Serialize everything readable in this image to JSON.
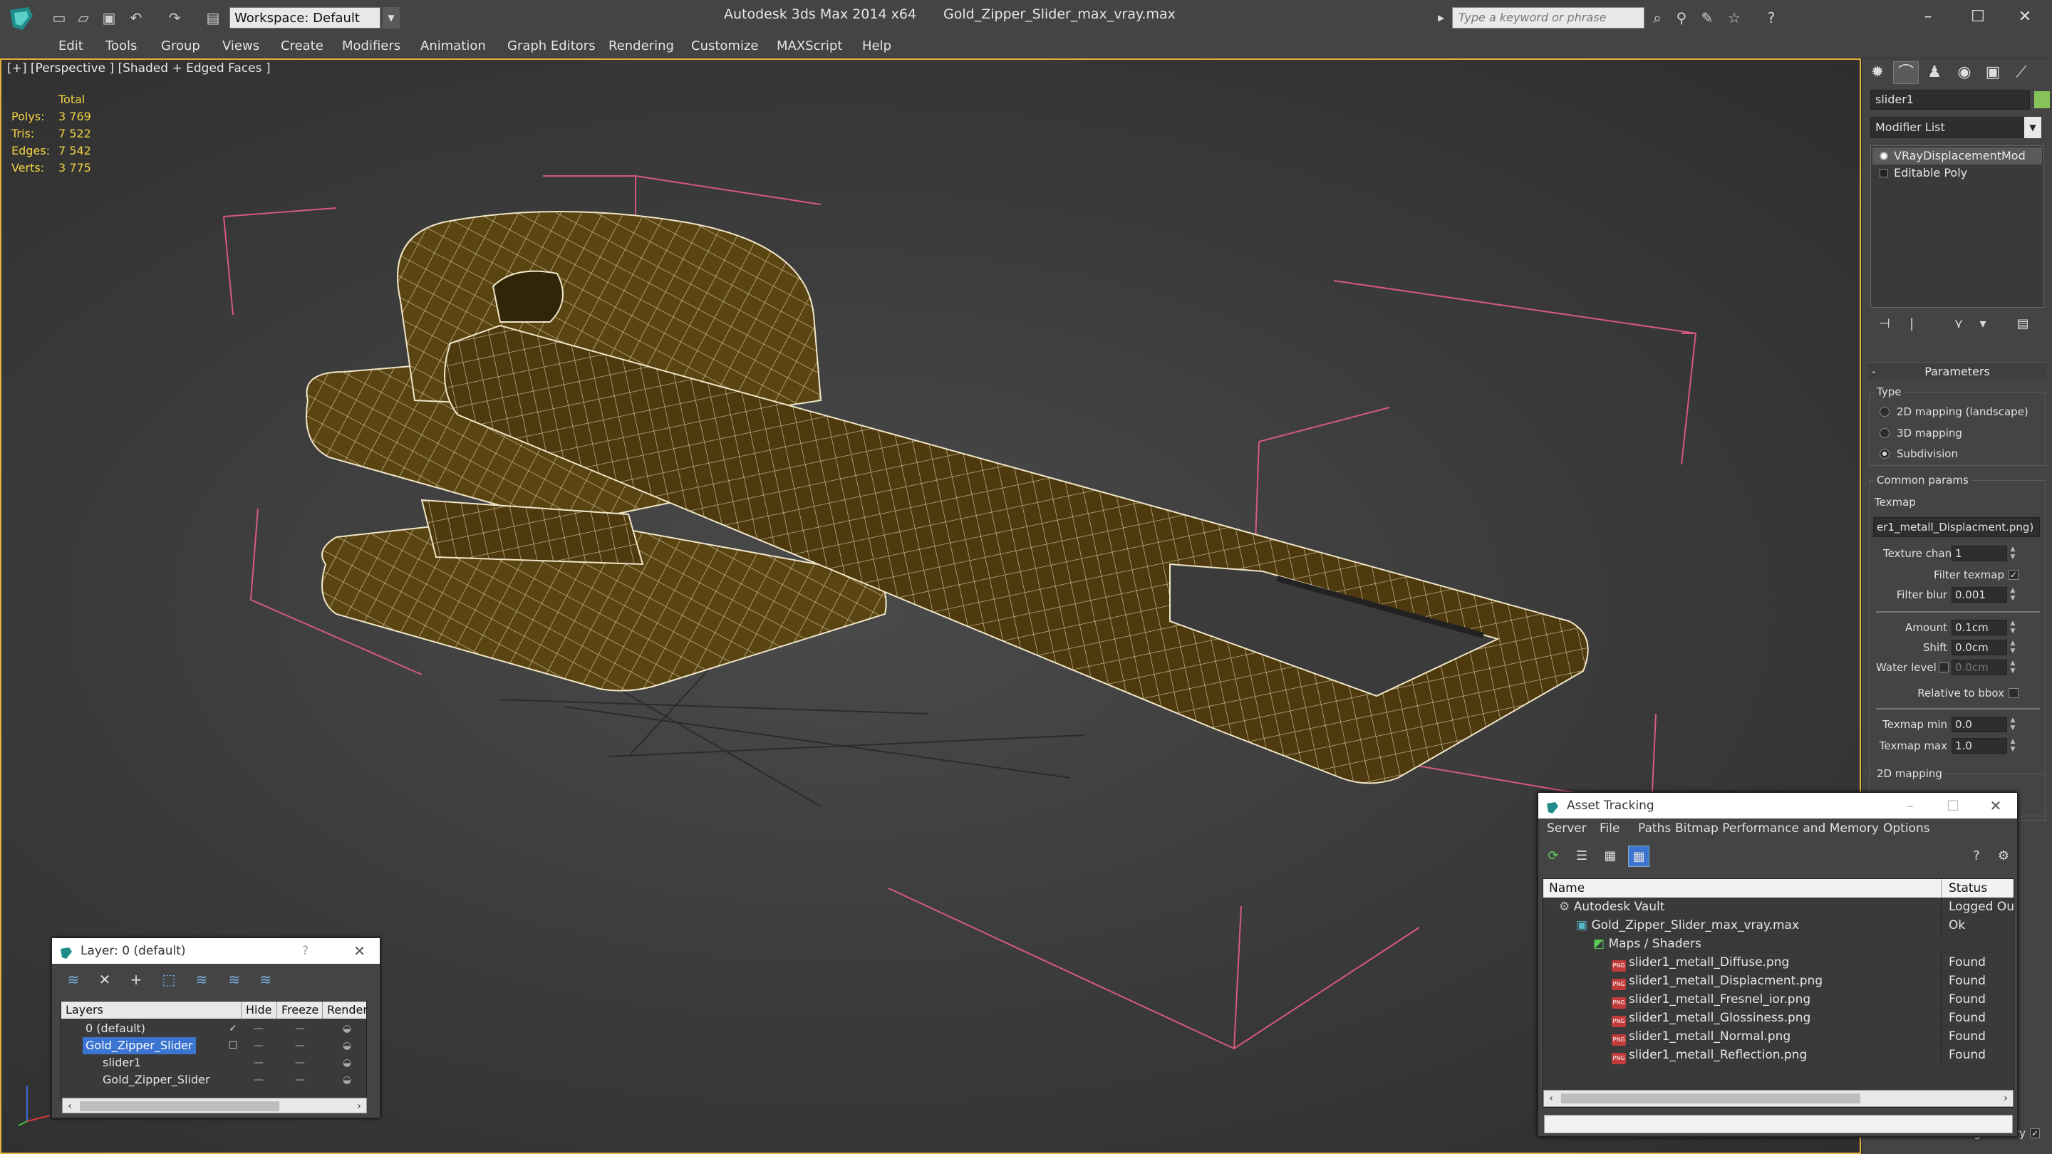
{
  "titlebar": {
    "workspace": "Workspace: Default",
    "app_title": "Autodesk 3ds Max  2014 x64",
    "file_name": "Gold_Zipper_Slider_max_vray.max",
    "search_placeholder": "Type a keyword or phrase"
  },
  "menu": [
    "Edit",
    "Tools",
    "Group",
    "Views",
    "Create",
    "Modifiers",
    "Animation",
    "Graph Editors",
    "Rendering",
    "Customize",
    "MAXScript",
    "Help"
  ],
  "viewport": {
    "label": "[+] [Perspective ] [Shaded + Edged Faces ]",
    "stats": {
      "header": "Total",
      "rows": [
        {
          "k": "Polys:",
          "v": "3 769"
        },
        {
          "k": "Tris:",
          "v": "7 522"
        },
        {
          "k": "Edges:",
          "v": "7 542"
        },
        {
          "k": "Verts:",
          "v": "3 775"
        }
      ]
    }
  },
  "command_panel": {
    "object_name": "slider1",
    "object_color": "#86c45a",
    "modifier_list": "Modifier List",
    "stack": [
      "VRayDisplacementMod",
      "Editable Poly"
    ],
    "rollout": "Parameters",
    "type_group": "Type",
    "type_options": [
      "2D mapping (landscape)",
      "3D mapping",
      "Subdivision"
    ],
    "common_group": "Common params",
    "texmap_label": "Texmap",
    "texmap_value": "er1_metall_Displacment.png)",
    "texture_chan_label": "Texture chan",
    "texture_chan_value": "1",
    "filter_texmap_label": "Filter texmap",
    "filter_blur_label": "Filter blur",
    "filter_blur_value": "0.001",
    "amount_label": "Amount",
    "amount_value": "0.1cm",
    "shift_label": "Shift",
    "shift_value": "0.0cm",
    "water_level_label": "Water level",
    "water_level_value": "0.0cm",
    "relative_bbox_label": "Relative to bbox",
    "texmap_min_label": "Texmap min",
    "texmap_min_value": "0.0",
    "texmap_max_label": "Texmap max",
    "texmap_max_value": "1.0",
    "mapping_2d_group": "2D mapping",
    "static_geometry_label": "Static geometry"
  },
  "layer_dialog": {
    "title": "Layer: 0 (default)",
    "help": "?",
    "columns": [
      "Layers",
      "Hide",
      "Freeze",
      "Render"
    ],
    "rows": [
      "0 (default)",
      "Gold_Zipper_Slider",
      "slider1",
      "Gold_Zipper_Slider"
    ]
  },
  "asset_dialog": {
    "title": "Asset Tracking",
    "menu": [
      "Server",
      "File",
      "Paths",
      "Bitmap Performance and Memory",
      "Options"
    ],
    "columns": [
      "Name",
      "Status"
    ],
    "rows": [
      {
        "name": "Autodesk Vault",
        "status": "Logged Out"
      },
      {
        "name": "Gold_Zipper_Slider_max_vray.max",
        "status": "Ok"
      },
      {
        "name": "Maps / Shaders",
        "status": ""
      },
      {
        "name": "slider1_metall_Diffuse.png",
        "status": "Found"
      },
      {
        "name": "slider1_metall_Displacment.png",
        "status": "Found"
      },
      {
        "name": "slider1_metall_Fresnel_ior.png",
        "status": "Found"
      },
      {
        "name": "slider1_metall_Glossiness.png",
        "status": "Found"
      },
      {
        "name": "slider1_metall_Normal.png",
        "status": "Found"
      },
      {
        "name": "slider1_metall_Reflection.png",
        "status": "Found"
      }
    ],
    "file_type_badge": "PNG"
  }
}
